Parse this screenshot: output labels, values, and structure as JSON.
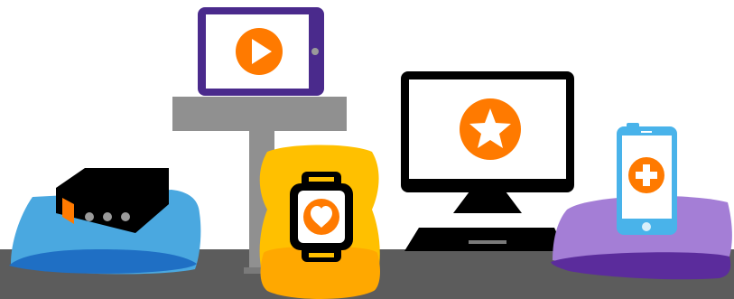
{
  "scene": {
    "devices": [
      {
        "name": "set-top-box",
        "icon": "dots-icon"
      },
      {
        "name": "tablet",
        "icon": "play-icon"
      },
      {
        "name": "smartwatch",
        "icon": "heart-icon"
      },
      {
        "name": "desktop-computer",
        "icon": "star-icon"
      },
      {
        "name": "smartphone",
        "icon": "plus-icon"
      }
    ],
    "colors": {
      "accent": "#ff7a00",
      "table": "#5c5c5c",
      "pedestal": "#909090",
      "tablet_frame": "#4a2a8c",
      "watch_cushion": "#ffc000",
      "watch_cushion_dark": "#ff9f00",
      "box_cushion": "#4aa8e0",
      "box_cushion_dark": "#1f6fc4",
      "phone_cushion": "#a47ed6",
      "phone_cushion_dark": "#5b2c9c",
      "phone_frame": "#49b3ea",
      "monitor": "#000000"
    }
  }
}
